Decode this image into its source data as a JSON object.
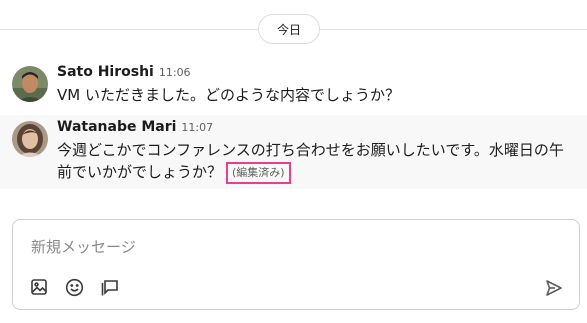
{
  "divider": {
    "label": "今日"
  },
  "messages": [
    {
      "author": "Sato Hiroshi",
      "time": "11:06",
      "avatar": "avatar-man",
      "text": "VM いただきました。どのような内容でしょうか？"
    },
    {
      "author": "Watanabe Mari",
      "time": "11:07",
      "avatar": "avatar-woman",
      "text": "今週どこかでコンファレンスの打ち合わせをお願いしたいです。水曜日の午前でいかがでしょうか？",
      "edited": "(編集済み)"
    }
  ],
  "composer": {
    "placeholder": "新規メッセージ",
    "value": "",
    "tools": [
      "image-icon",
      "emoji-icon",
      "shortcut-icon"
    ],
    "send_icon": "send-icon"
  },
  "colors": {
    "highlight": "#ec3f8b",
    "hover_bg": "#f8f8f8",
    "muted": "#616061"
  }
}
